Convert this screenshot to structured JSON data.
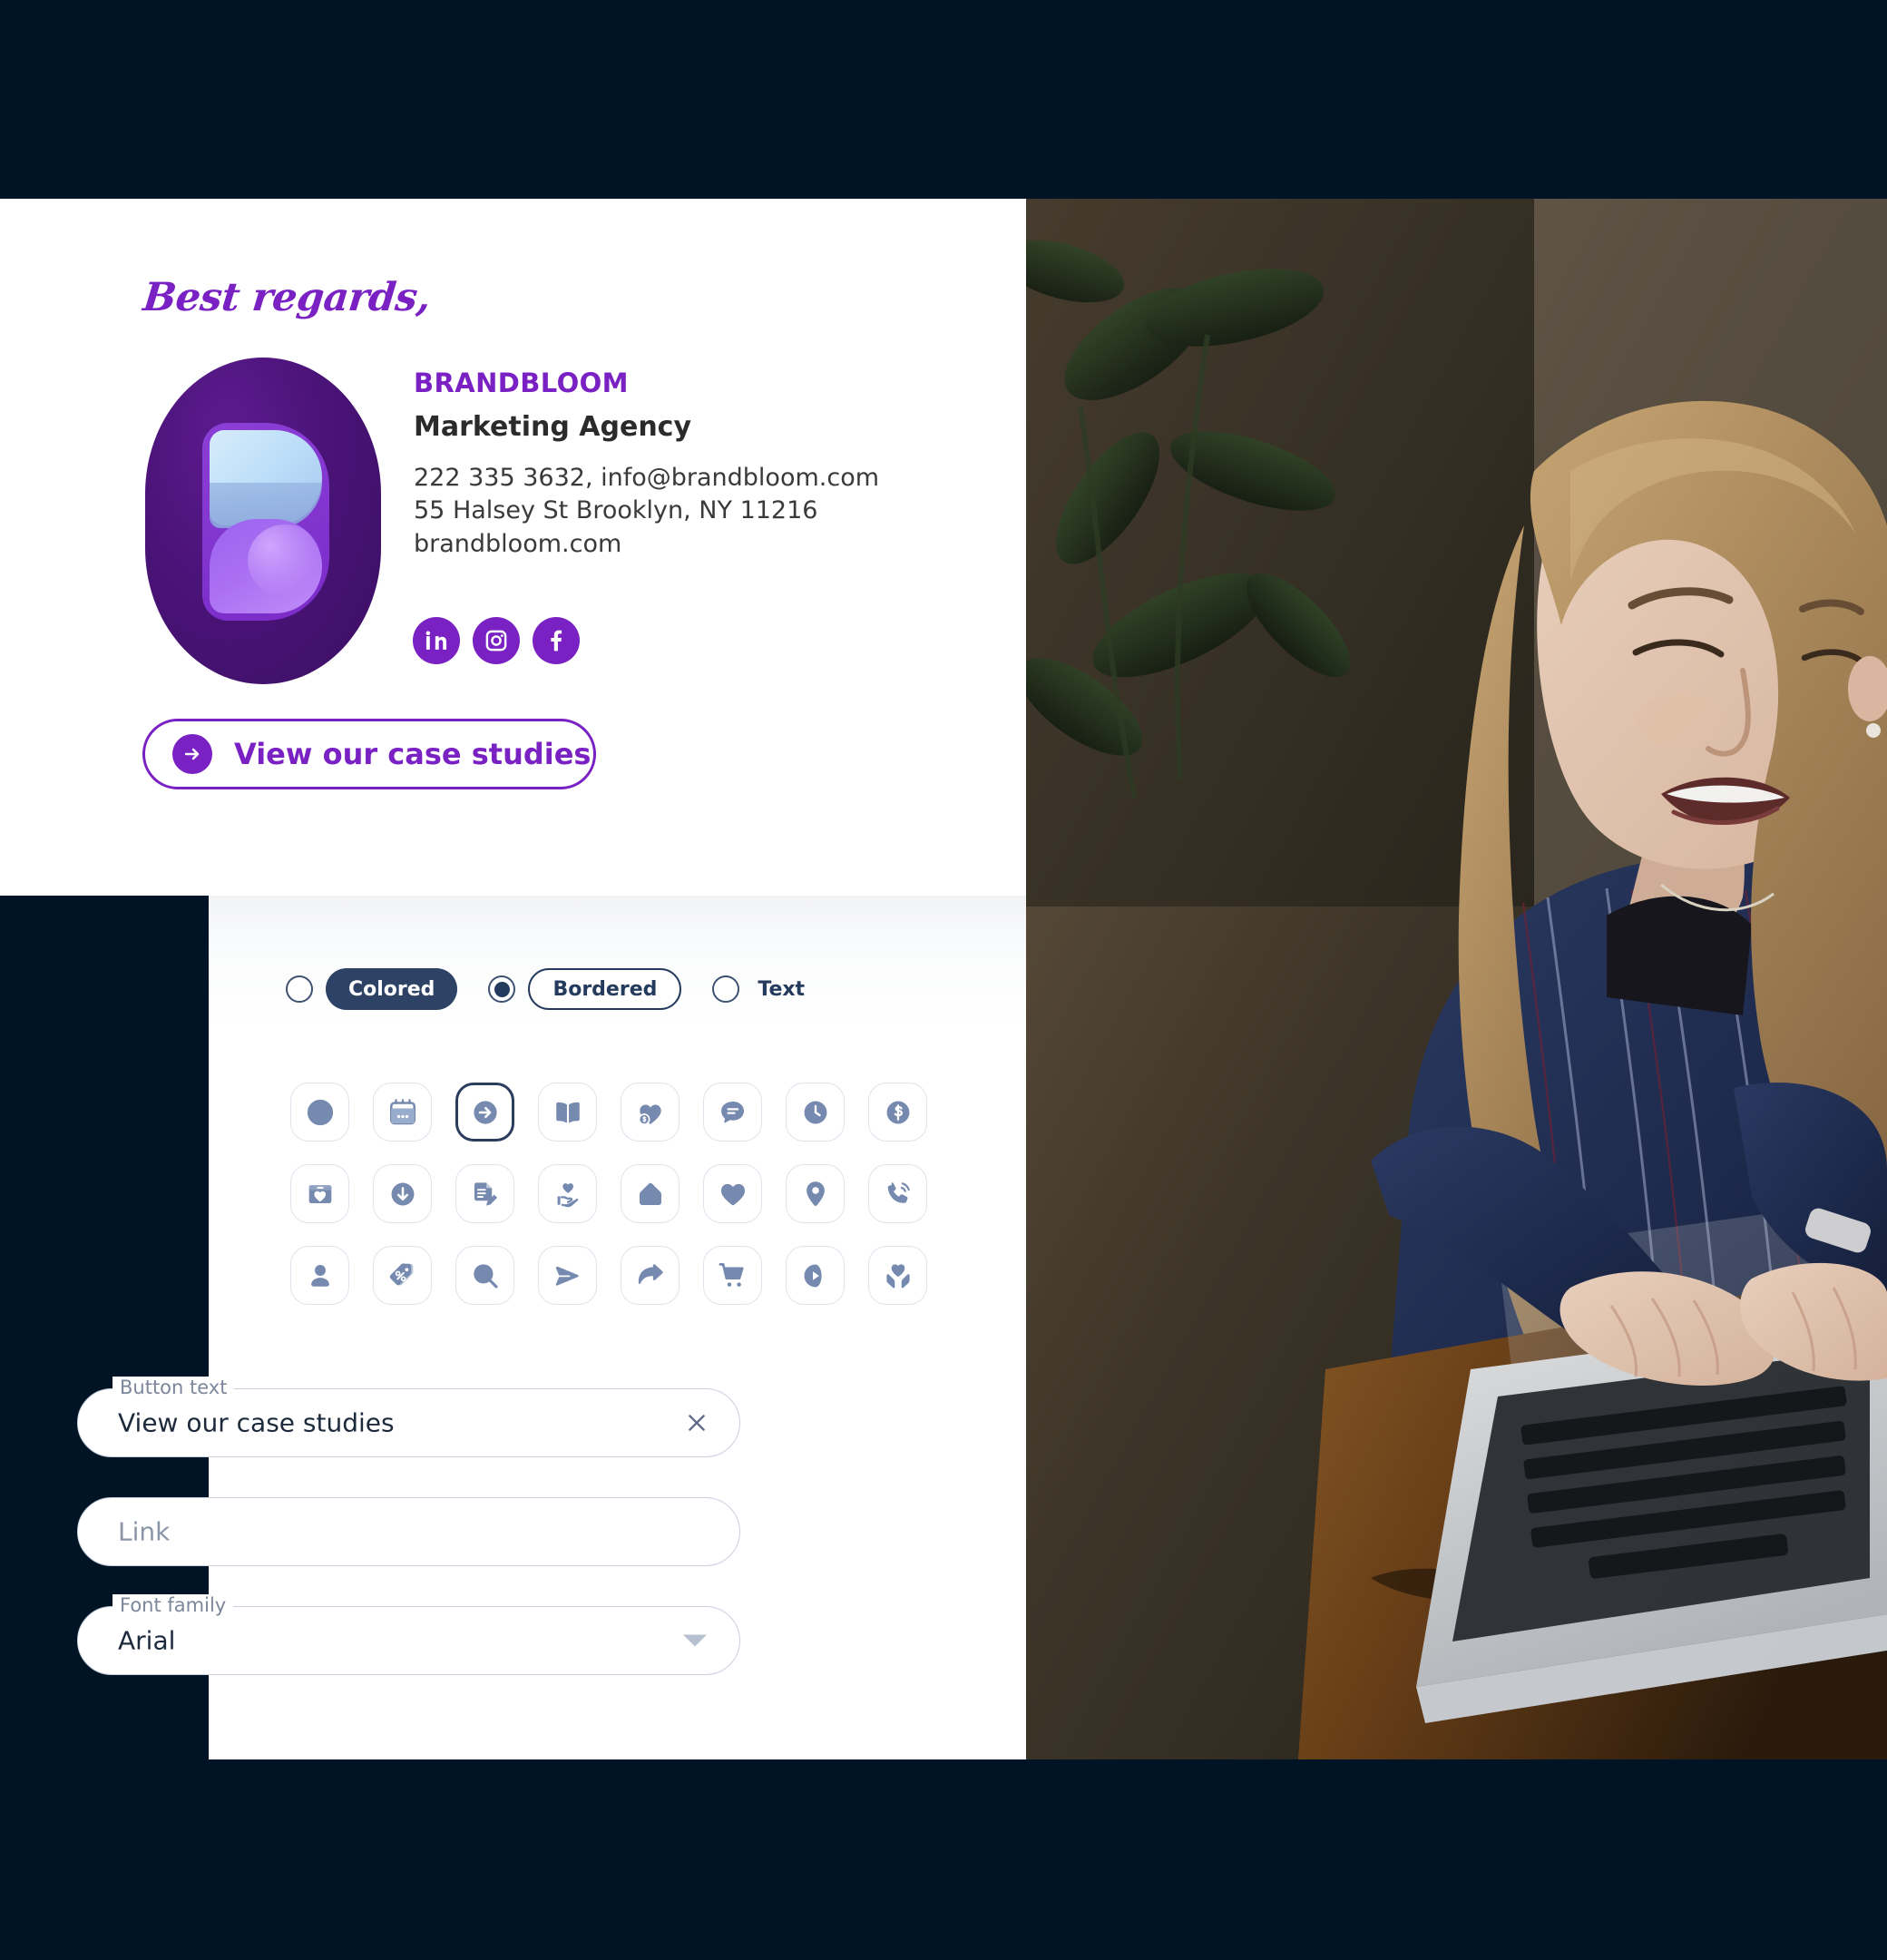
{
  "theme": {
    "page_background": "#011425",
    "brand_purple": "#7A21C4",
    "navy": "#2E4265",
    "icon_blue_gray": "#768AB0",
    "panel_white": "#FFFFFF"
  },
  "signature": {
    "greeting": "Best regards,",
    "logo_name": "brandbloom-logo",
    "company": "BRANDBLOOM",
    "role": "Marketing Agency",
    "contact_lines": [
      "222 335 3632, info@brandbloom.com",
      "55 Halsey St Brooklyn, NY 11216",
      "brandbloom.com"
    ],
    "socials": [
      {
        "name": "linkedin",
        "label": "LinkedIn"
      },
      {
        "name": "instagram",
        "label": "Instagram"
      },
      {
        "name": "facebook",
        "label": "Facebook"
      }
    ],
    "cta": {
      "icon": "arrow-right-circle-icon",
      "label": "View our case studies"
    }
  },
  "editor": {
    "style_options": [
      {
        "label": "Colored",
        "variant": "colored",
        "selected": false
      },
      {
        "label": "Bordered",
        "variant": "bordered",
        "selected": true
      },
      {
        "label": "Text",
        "variant": "text",
        "selected": false
      }
    ],
    "icons": [
      {
        "name": "no-icon",
        "selected": false
      },
      {
        "name": "calendar-icon",
        "selected": false
      },
      {
        "name": "arrow-right-circle-icon",
        "selected": true
      },
      {
        "name": "open-book-icon",
        "selected": false
      },
      {
        "name": "heart-dollar-icon",
        "selected": false
      },
      {
        "name": "chat-bubble-icon",
        "selected": false
      },
      {
        "name": "clock-icon",
        "selected": false
      },
      {
        "name": "dollar-circle-icon",
        "selected": false
      },
      {
        "name": "donation-box-icon",
        "selected": false
      },
      {
        "name": "download-circle-icon",
        "selected": false
      },
      {
        "name": "document-edit-icon",
        "selected": false
      },
      {
        "name": "hand-heart-icon",
        "selected": false
      },
      {
        "name": "home-icon",
        "selected": false
      },
      {
        "name": "heart-icon",
        "selected": false
      },
      {
        "name": "map-pin-icon",
        "selected": false
      },
      {
        "name": "phone-ring-icon",
        "selected": false
      },
      {
        "name": "user-icon",
        "selected": false
      },
      {
        "name": "discount-tag-icon",
        "selected": false
      },
      {
        "name": "search-icon",
        "selected": false
      },
      {
        "name": "send-icon",
        "selected": false
      },
      {
        "name": "share-arrow-icon",
        "selected": false
      },
      {
        "name": "shopping-cart-icon",
        "selected": false
      },
      {
        "name": "play-circle-icon",
        "selected": false
      },
      {
        "name": "hands-heart-icon",
        "selected": false
      }
    ],
    "fields": {
      "button_text": {
        "label": "Button text",
        "value": "View our case studies",
        "clear_icon": "close-icon"
      },
      "link": {
        "label": "",
        "placeholder": "Link",
        "value": ""
      },
      "font_family": {
        "label": "Font family",
        "value": "Arial",
        "caret_icon": "chevron-down-icon"
      }
    }
  },
  "photo": {
    "alt": "Smiling woman in striped blue blouse typing on a laptop at a wooden cafe table"
  }
}
